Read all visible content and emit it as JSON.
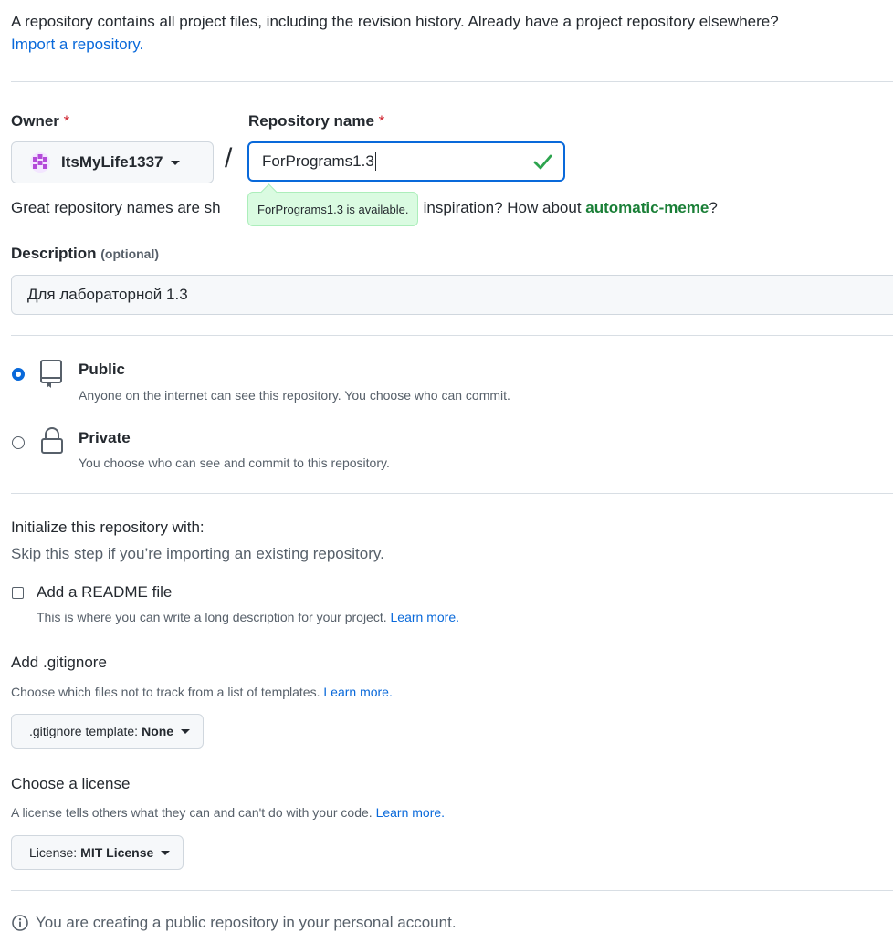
{
  "intro": {
    "text": "A repository contains all project files, including the revision history. Already have a project repository elsewhere?",
    "import_link": "Import a repository."
  },
  "owner": {
    "label": "Owner",
    "required_mark": "*",
    "value": "ItsMyLife1337"
  },
  "separator": "/",
  "repo_name": {
    "label": "Repository name",
    "required_mark": "*",
    "value": "ForPrograms1.3",
    "status_icon": "check-icon"
  },
  "availability_tooltip": "ForPrograms1.3 is available.",
  "helper": {
    "prefix": "Great repository names are sh",
    "middle": "inspiration? How about ",
    "suggestion": "automatic-meme",
    "suffix": "?"
  },
  "description": {
    "label": "Description",
    "optional": "(optional)",
    "value": "Для лабораторной 1.3"
  },
  "visibility": {
    "public": {
      "title": "Public",
      "subtitle": "Anyone on the internet can see this repository. You choose who can commit.",
      "selected": true,
      "icon": "repo-icon"
    },
    "private": {
      "title": "Private",
      "subtitle": "You choose who can see and commit to this repository.",
      "selected": false,
      "icon": "lock-icon"
    }
  },
  "initialize": {
    "title": "Initialize this repository with:",
    "subtitle": "Skip this step if you’re importing an existing repository.",
    "readme": {
      "label": "Add a README file",
      "description": "This is where you can write a long description for your project.",
      "learn_more": "Learn more.",
      "checked": false
    }
  },
  "gitignore": {
    "title": "Add .gitignore",
    "description": "Choose which files not to track from a list of templates.",
    "learn_more": "Learn more.",
    "select_prefix": ".gitignore template:",
    "select_value": "None"
  },
  "license": {
    "title": "Choose a license",
    "description": "A license tells others what they can and can't do with your code.",
    "learn_more": "Learn more.",
    "select_prefix": "License:",
    "select_value": "MIT License"
  },
  "notice": {
    "icon": "info-icon",
    "text": "You are creating a public repository in your personal account."
  },
  "colors": {
    "link": "#0969da",
    "success": "#1a7f37",
    "required": "#cf222e",
    "focus": "#0969da",
    "tooltip_bg": "#dafbe1"
  }
}
